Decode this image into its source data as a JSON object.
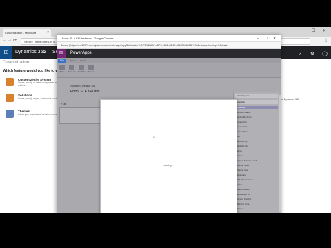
{
  "browser": {
    "tab_title": "Customization - Microsoft",
    "tab_close": "×",
    "window_controls": [
      "–",
      "☐",
      "✕"
    ],
    "nav": [
      "←",
      "→",
      "⟳"
    ],
    "url": "Secure | https://orel19971.crm.dynamics.com/main.aspx?settingsonly=true#customization",
    "menu": "⋮"
  },
  "d365_header": {
    "waffle_icon": "grid-icon",
    "brand": "Dynamics 365",
    "chevron": "⌄",
    "section": "Se",
    "icons": [
      "?",
      "⚙",
      "◯"
    ]
  },
  "customization": {
    "title": "Customization",
    "question": "Which feature would you like to work",
    "options": [
      {
        "title": "Customize the System",
        "desc": "Create, modify, or delete components and entities.",
        "color": "#d9822b"
      },
      {
        "title": "Solutions",
        "desc": "Create, modify, export, or import a solution.",
        "color": "#d9822b"
      },
      {
        "title": "Themes",
        "desc": "Adjust your organization's custom theme.",
        "color": "#5c7fb8"
      }
    ],
    "right_text": "toad Dynamics 365"
  },
  "popup": {
    "title": "Form: SLA KPI Instance - Google Chrome",
    "controls": [
      "–",
      "☐",
      "✕"
    ],
    "url": "Secure | https://orel19971.crm.dynamics.com/main.aspx?appSolutionId=%7bFD140AAF-4DF4-11DD-BD17-0019B9312238%7d&extraqs=formtype%3dmain",
    "app_brand": "PowerApps",
    "ribbon_tabs": [
      "File",
      "Home",
      "Insert"
    ],
    "ribbon_buttons": [
      "Save",
      "Save As",
      "Publish",
      "Preview"
    ],
    "solution_label": "Solution: Default Sol",
    "form_label": "Form: SLA KPI Inst",
    "tab_label": "▾ Tab",
    "field_explorer": {
      "header": "Field Explorer",
      "filter": "Available",
      "items": [
        "New Field",
        "Account Name",
        "Applicable From",
        "Created By",
        "Created On",
        "Failure Time",
        "KPI",
        "Modified By",
        "Modified On",
        "Name",
        "Owner",
        "Owning Business Unit",
        "Owning Team",
        "Owning User",
        "Regarding",
        "SLA KPI Instance",
        "Status",
        "Status Reason",
        "Succeeded On",
        "Version Number",
        "Warning Time",
        "Owner",
        "Regarding",
        "Status"
      ],
      "selected_index": 0
    }
  },
  "modal": {
    "cursor": "↖",
    "loading_text": "Loading..."
  }
}
